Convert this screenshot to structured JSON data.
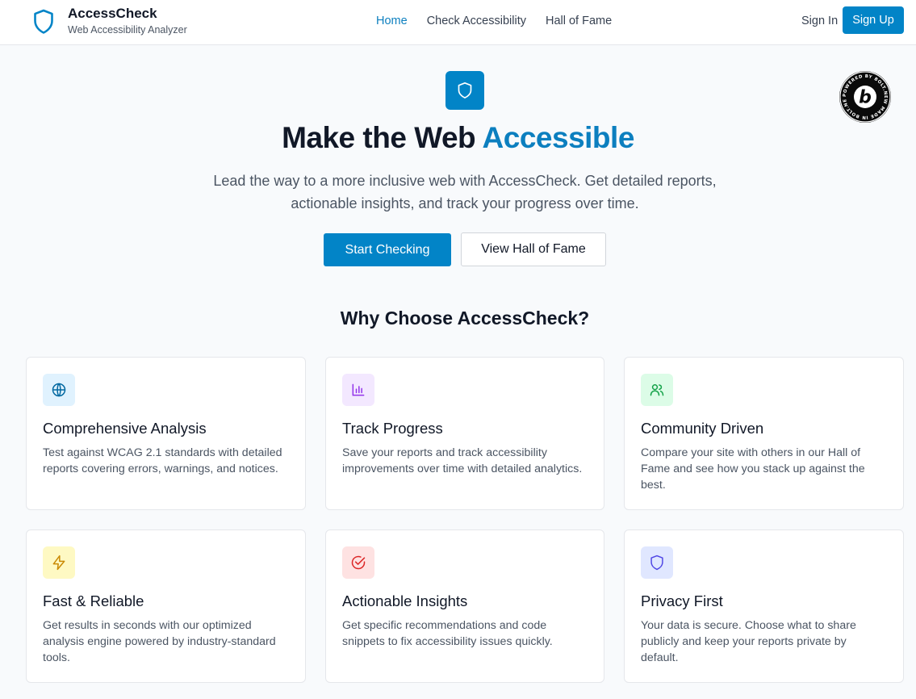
{
  "header": {
    "brand_name": "AccessCheck",
    "brand_sub": "Web Accessibility Analyzer",
    "brand_icon": "shield-icon",
    "nav": [
      {
        "label": "Home",
        "active": true
      },
      {
        "label": "Check Accessibility",
        "active": false
      },
      {
        "label": "Hall of Fame",
        "active": false
      }
    ],
    "sign_in": "Sign In",
    "sign_up": "Sign Up"
  },
  "hero": {
    "icon": "shield-icon",
    "title_main": "Make the Web",
    "title_accent": "Accessible",
    "description": "Lead the way to a more inclusive web with AccessCheck. Get detailed reports, actionable insights, and track your progress over time.",
    "primary_button": "Start Checking",
    "secondary_button": "View Hall of Fame"
  },
  "badge": {
    "ring_text": "POWERED BY BOLT.NEW MADE IN BOLT.NEW",
    "letter": "b"
  },
  "features": {
    "title": "Why Choose AccessCheck?",
    "cards": [
      {
        "icon": "globe-icon",
        "title": "Comprehensive Analysis",
        "desc": "Test against WCAG 2.1 standards with detailed reports covering errors, warnings, and notices."
      },
      {
        "icon": "bar-chart-icon",
        "title": "Track Progress",
        "desc": "Save your reports and track accessibility improvements over time with detailed analytics."
      },
      {
        "icon": "users-icon",
        "title": "Community Driven",
        "desc": "Compare your site with others in our Hall of Fame and see how you stack up against the best."
      },
      {
        "icon": "lightning-icon",
        "title": "Fast & Reliable",
        "desc": "Get results in seconds with our optimized analysis engine powered by industry-standard tools."
      },
      {
        "icon": "check-circle-icon",
        "title": "Actionable Insights",
        "desc": "Get specific recommendations and code snippets to fix accessibility issues quickly."
      },
      {
        "icon": "shield-icon",
        "title": "Privacy First",
        "desc": "Your data is secure. Choose what to share publicly and keep your reports private by default."
      }
    ]
  },
  "colors": {
    "primary": "#0284c7",
    "accent_text": "#0c7fbf",
    "background": "#f8fafc"
  }
}
